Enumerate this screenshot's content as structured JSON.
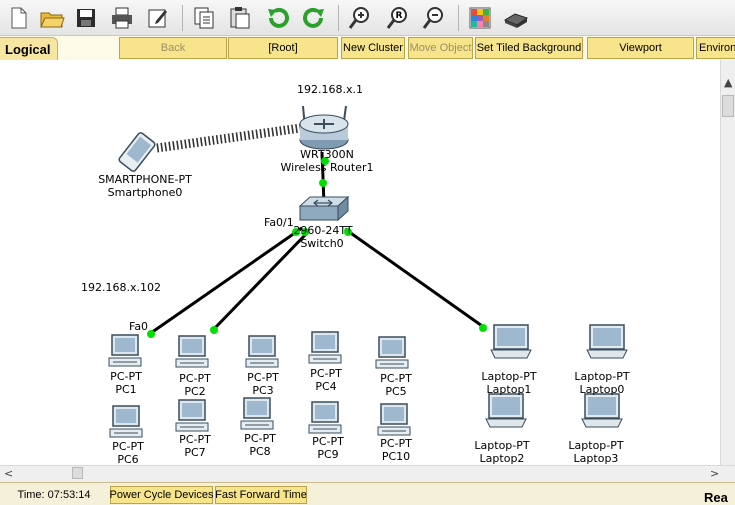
{
  "toolbar": {
    "buttons": [
      "new-icon",
      "open-icon",
      "save-icon",
      "print-icon",
      "activity-wizard-icon",
      "copy-icon",
      "paste-icon",
      "undo-icon",
      "redo-icon",
      "zoom-in-icon",
      "zoom-reset-icon",
      "zoom-out-icon",
      "palette-icon",
      "custom-device-icon"
    ]
  },
  "nav": {
    "tab_label": "Logical",
    "back": "Back",
    "root": "[Root]",
    "new_cluster": "New Cluster",
    "move_object": "Move Object",
    "set_tiled_background": "Set Tiled Background",
    "viewport": "Viewport",
    "environment": "Environment"
  },
  "network": {
    "router": {
      "ip": "192.168.x.1",
      "model": "WRT300N",
      "name": "Wireless Router1"
    },
    "smartphone": {
      "model": "SMARTPHONE-PT",
      "name": "Smartphone0"
    },
    "switch": {
      "model": "2960-24TT",
      "name": "Switch0",
      "port": "Fa0/1"
    },
    "pc_ip": "192.168.x.102",
    "pc_port": "Fa0",
    "pcs": [
      {
        "model": "PC-PT",
        "name": "PC1"
      },
      {
        "model": "PC-PT",
        "name": "PC2"
      },
      {
        "model": "PC-PT",
        "name": "PC3"
      },
      {
        "model": "PC-PT",
        "name": "PC4"
      },
      {
        "model": "PC-PT",
        "name": "PC5"
      },
      {
        "model": "PC-PT",
        "name": "PC6"
      },
      {
        "model": "PC-PT",
        "name": "PC7"
      },
      {
        "model": "PC-PT",
        "name": "PC8"
      },
      {
        "model": "PC-PT",
        "name": "PC9"
      },
      {
        "model": "PC-PT",
        "name": "PC10"
      }
    ],
    "laptops": [
      {
        "model": "Laptop-PT",
        "name": "Laptop1"
      },
      {
        "model": "Laptop-PT",
        "name": "Laptop0"
      },
      {
        "model": "Laptop-PT",
        "name": "Laptop2"
      },
      {
        "model": "Laptop-PT",
        "name": "Laptop3"
      }
    ]
  },
  "status": {
    "time": "Time: 07:53:14",
    "power_cycle": "Power Cycle Devices",
    "fast_forward": "Fast Forward Time",
    "realtime": "Rea"
  },
  "colors": {
    "link_up": "#00e000",
    "button": "#f8e48a",
    "link": "#000000"
  }
}
